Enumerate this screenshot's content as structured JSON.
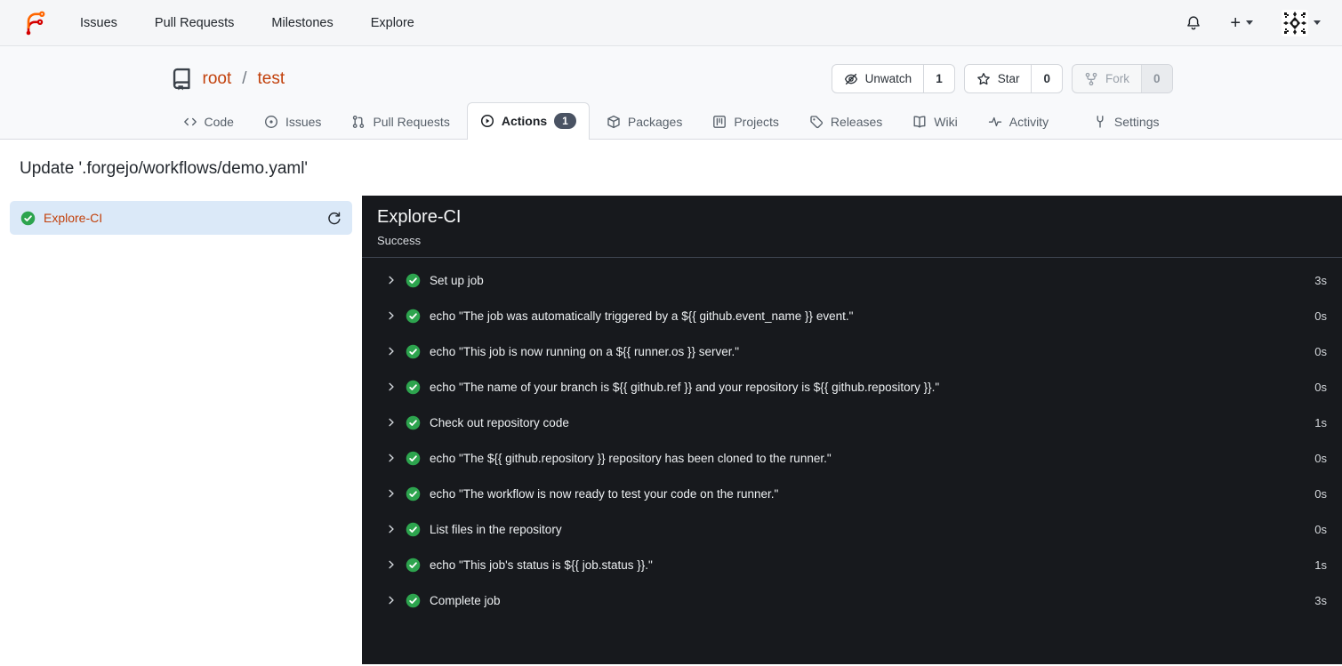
{
  "navbar": {
    "brand_icon": "forgejo-logo",
    "items": [
      "Issues",
      "Pull Requests",
      "Milestones",
      "Explore"
    ],
    "right_icons": [
      "bell-icon",
      "plus-icon",
      "avatar-identicon",
      "caret-down-icon"
    ]
  },
  "repo_header": {
    "repo_icon": "repo-book-icon",
    "owner": "root",
    "separator": "/",
    "name": "test",
    "buttons": [
      {
        "label": "Unwatch",
        "icon": "eye-slash-icon",
        "count": "1",
        "disabled": false
      },
      {
        "label": "Star",
        "icon": "star-icon",
        "count": "0",
        "disabled": false
      },
      {
        "label": "Fork",
        "icon": "fork-icon",
        "count": "0",
        "disabled": true
      }
    ],
    "tabs": [
      {
        "label": "Code",
        "icon": "code-icon",
        "active": false
      },
      {
        "label": "Issues",
        "icon": "issue-icon",
        "active": false
      },
      {
        "label": "Pull Requests",
        "icon": "pull-request-icon",
        "active": false
      },
      {
        "label": "Actions",
        "icon": "play-circle-icon",
        "active": true,
        "badge": "1"
      },
      {
        "label": "Packages",
        "icon": "package-icon",
        "active": false
      },
      {
        "label": "Projects",
        "icon": "project-icon",
        "active": false
      },
      {
        "label": "Releases",
        "icon": "tag-icon",
        "active": false
      },
      {
        "label": "Wiki",
        "icon": "book-icon",
        "active": false
      },
      {
        "label": "Activity",
        "icon": "pulse-icon",
        "active": false
      },
      {
        "label": "Settings",
        "icon": "tools-icon",
        "active": false,
        "align_right": true
      }
    ]
  },
  "run": {
    "title": "Update '.forgejo/workflows/demo.yaml'",
    "jobs": [
      {
        "name": "Explore-CI",
        "status": "success",
        "status_icon": "success-check-icon",
        "action_icon": "refresh-icon",
        "selected": true
      }
    ],
    "job_detail": {
      "name": "Explore-CI",
      "status_text": "Success"
    },
    "steps": [
      {
        "name": "Set up job",
        "duration": "3s"
      },
      {
        "name": "echo \"The job was automatically triggered by a ${{ github.event_name }} event.\"",
        "duration": "0s"
      },
      {
        "name": "echo \"This job is now running on a ${{ runner.os }} server.\"",
        "duration": "0s"
      },
      {
        "name": "echo \"The name of your branch is ${{ github.ref }} and your repository is ${{ github.repository }}.\"",
        "duration": "0s"
      },
      {
        "name": "Check out repository code",
        "duration": "1s"
      },
      {
        "name": "echo \"The ${{ github.repository }} repository has been cloned to the runner.\"",
        "duration": "0s"
      },
      {
        "name": "echo \"The workflow is now ready to test your code on the runner.\"",
        "duration": "0s"
      },
      {
        "name": "List files in the repository",
        "duration": "0s"
      },
      {
        "name": "echo \"This job's status is ${{ job.status }}.\"",
        "duration": "1s"
      },
      {
        "name": "Complete job",
        "duration": "3s"
      }
    ]
  },
  "colors": {
    "accent_link": "#c2410c",
    "success_green": "#2da44e",
    "log_panel_bg": "#17191d",
    "selected_job_bg": "#dbe9f8",
    "badge_bg": "#4a5363"
  }
}
